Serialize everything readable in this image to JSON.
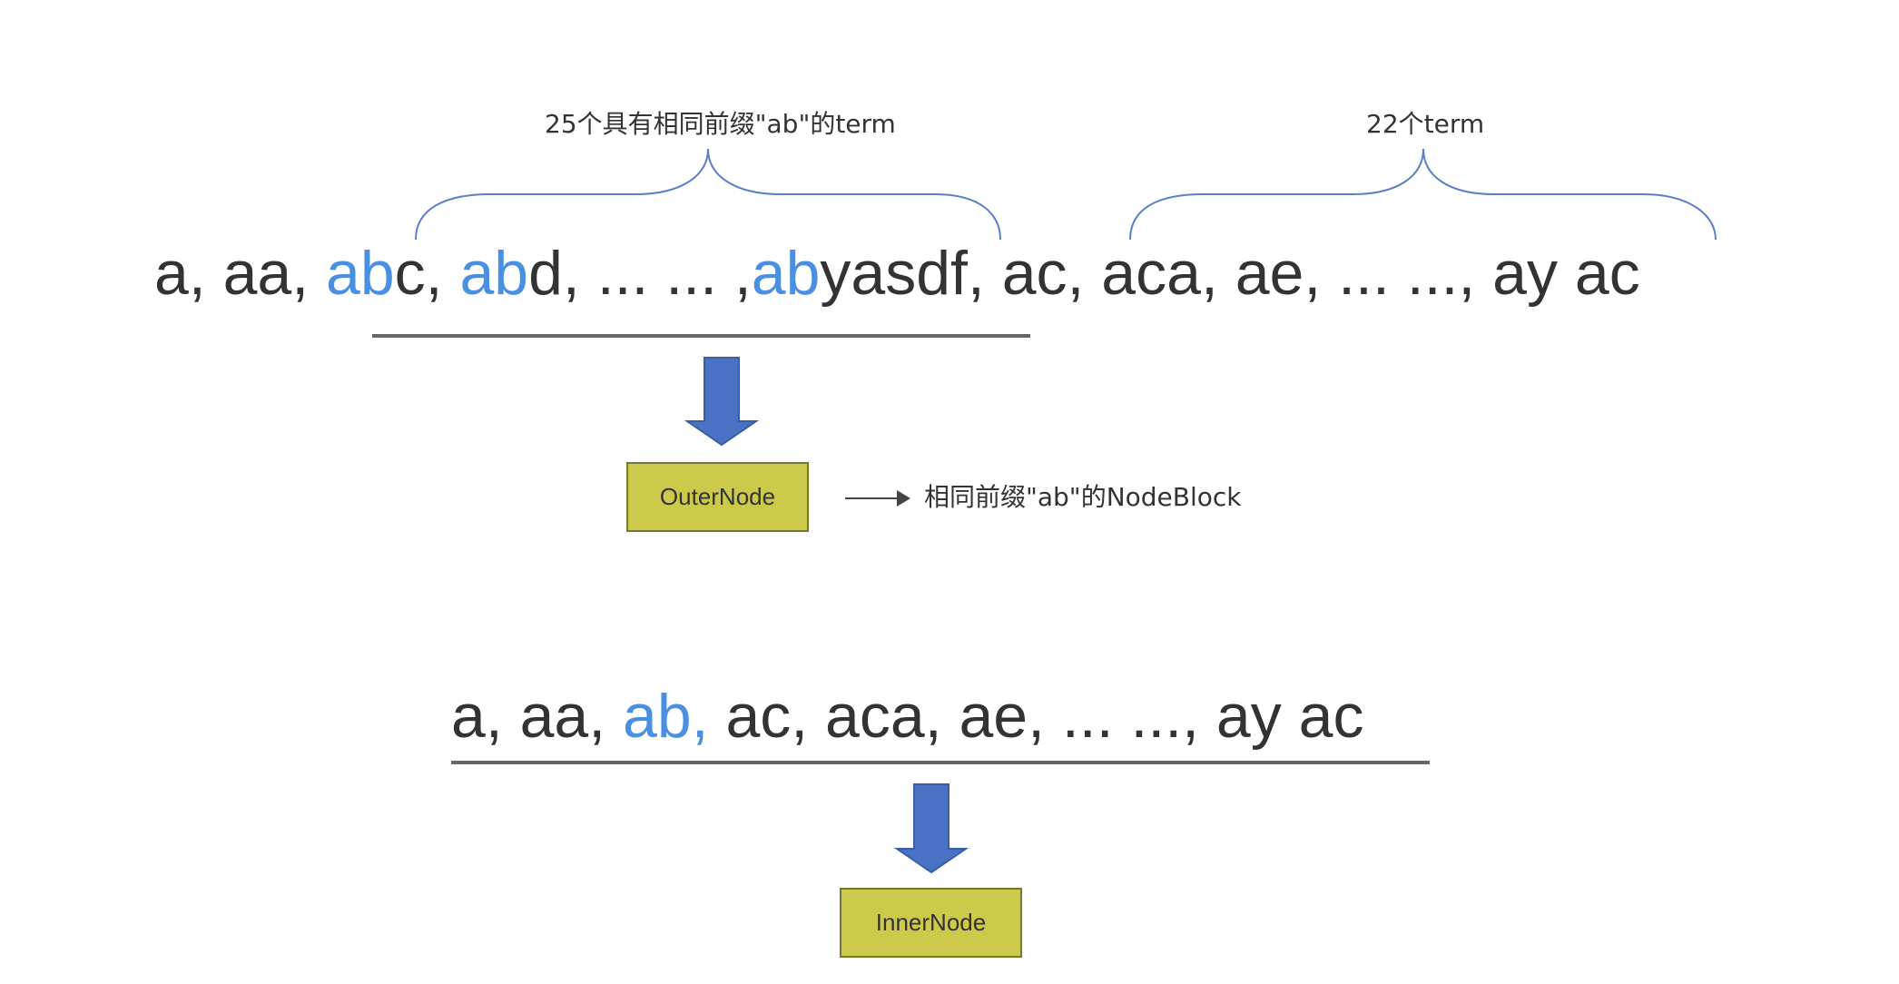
{
  "top_row": {
    "segments": [
      {
        "text": "a, aa,  ",
        "highlight": false
      },
      {
        "text": "ab",
        "highlight": true
      },
      {
        "text": "c, ",
        "highlight": false
      },
      {
        "text": "ab",
        "highlight": true
      },
      {
        "text": "d, ... ... ,",
        "highlight": false
      },
      {
        "text": "ab",
        "highlight": true
      },
      {
        "text": "yasdf,  ac, aca, ae, ... ..., ay ac",
        "highlight": false
      }
    ]
  },
  "brace_left_label": "25个具有相同前缀\"ab\"的term",
  "brace_right_label": "22个term",
  "outer_node": {
    "label": "OuterNode",
    "note": "相同前缀\"ab\"的NodeBlock"
  },
  "bottom_row": {
    "segments": [
      {
        "text": "a, aa, ",
        "highlight": false
      },
      {
        "text": "ab,",
        "highlight": true
      },
      {
        "text": " ac, aca, ae, ... ..., ay ac",
        "highlight": false
      }
    ]
  },
  "inner_node": {
    "label": "InnerNode"
  },
  "colors": {
    "highlight": "#4a90e2",
    "text": "#333333",
    "brace": "#5b7fc7",
    "arrow_fill": "#4a72c4",
    "node_fill": "#cdc94a"
  }
}
